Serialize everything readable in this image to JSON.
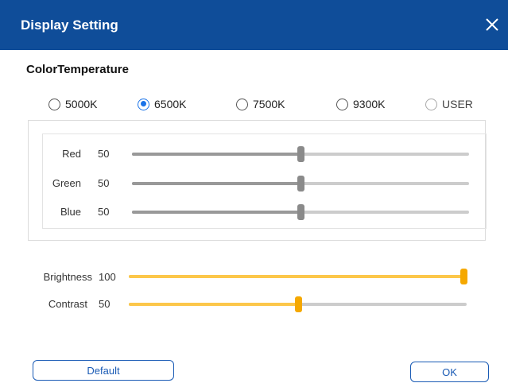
{
  "window": {
    "title": "Display Setting",
    "close_label": "✕"
  },
  "color_temperature": {
    "heading": "ColorTemperature",
    "presets": [
      {
        "label": "5000K",
        "checked": false,
        "enabled": true
      },
      {
        "label": "6500K",
        "checked": true,
        "enabled": true
      },
      {
        "label": "7500K",
        "checked": false,
        "enabled": true
      },
      {
        "label": "9300K",
        "checked": false,
        "enabled": true
      },
      {
        "label": "USER",
        "checked": false,
        "enabled": false
      }
    ],
    "channels": [
      {
        "label": "Red",
        "value": "50",
        "level": 0.5
      },
      {
        "label": "Green",
        "value": "50",
        "level": 0.5
      },
      {
        "label": "Blue",
        "value": "50",
        "level": 0.5
      }
    ]
  },
  "adjustments": [
    {
      "label": "Brightness",
      "value": "100",
      "level": 1.0
    },
    {
      "label": "Contrast",
      "value": "50",
      "level": 0.5
    }
  ],
  "buttons": {
    "default_label": "Default",
    "ok_label": "OK"
  },
  "colors": {
    "titlebar": "#0f4d99",
    "rgb_fill": "#999999",
    "rgb_thumb": "#8a8a8a",
    "adjust_fill": "#fcc74a",
    "adjust_thumb": "#f5a800",
    "radio_checked": "#1a73e8",
    "button_border": "#1a5bb5"
  }
}
